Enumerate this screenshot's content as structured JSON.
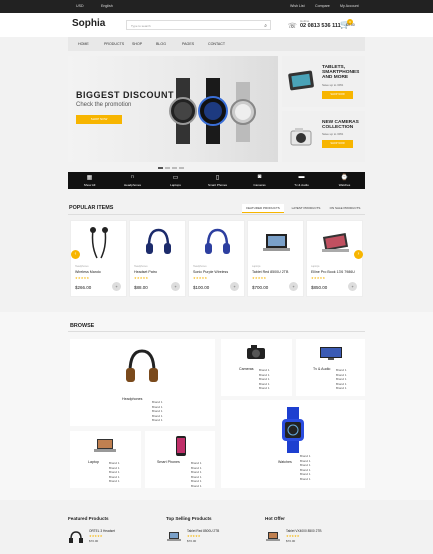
{
  "topbar": {
    "currency": "USD",
    "language": "English",
    "wishlist": "Wish List",
    "compare": "Compare",
    "account": "My Account"
  },
  "header": {
    "logo": "Sophia",
    "search_placeholder": "Type to search",
    "phone_label": "Hotline",
    "phone": "02 0813 536 111",
    "cart_count": "0",
    "cart_total": "$0.00"
  },
  "nav": [
    "HOME",
    "PRODUCTS",
    "SHOP",
    "BLOG",
    "PAGES",
    "CONTACT"
  ],
  "hero": {
    "title": "BIGGEST DISCOUNT",
    "subtitle": "Check the promotion",
    "button": "SHOP NOW"
  },
  "side_banners": [
    {
      "title1": "TABLETS,",
      "title2": "SMARTPHONES",
      "title3": "AND MORE",
      "sub": "Save up to 30%",
      "button": "SHOP NOW"
    },
    {
      "title1": "NEW CAMERAS",
      "title2": "COLLECTION",
      "title3": "",
      "sub": "Save up to 30%",
      "button": "SHOP NOW"
    }
  ],
  "categories": [
    {
      "label": "Show All",
      "icon": "grid-icon"
    },
    {
      "label": "Headphones",
      "icon": "headphones-icon"
    },
    {
      "label": "Laptops",
      "icon": "laptop-icon"
    },
    {
      "label": "Smart Phones",
      "icon": "phone-icon"
    },
    {
      "label": "Cameras",
      "icon": "camera-icon"
    },
    {
      "label": "Tv & Audio",
      "icon": "tv-icon"
    },
    {
      "label": "Watches",
      "icon": "watch-icon"
    }
  ],
  "popular": {
    "title": "POPULAR ITEMS",
    "tabs": [
      "FEATURED PRODUCTS",
      "LATEST PRODUCTS",
      "ON SALE PRODUCTS"
    ],
    "products": [
      {
        "name": "Wireless Mando",
        "category": "Headphones",
        "price": "$266.00",
        "stars": "★★★★★"
      },
      {
        "name": "Headset Patro",
        "category": "Headphones",
        "price": "$88.00",
        "stars": "★★★★★"
      },
      {
        "name": "Sonic Purple Wireless",
        "category": "Headphones",
        "price": "$100.00",
        "stars": "★★★★★"
      },
      {
        "name": "Tablet Red 8500U 2TB",
        "category": "Laptops",
        "price": "$700.00",
        "stars": "★★★★★"
      },
      {
        "name": "Elline Pro Book 13'6 7986U",
        "category": "Laptops",
        "price": "$850.00",
        "stars": "★★★★★"
      }
    ]
  },
  "browse": {
    "title": "BROWSE",
    "groups": [
      {
        "name": "Headphones",
        "brands": [
          "Brand 1",
          "Brand 1",
          "Brand 1",
          "Brand 1",
          "Brand 1",
          "Brand 1"
        ]
      },
      {
        "name": "Cameras",
        "brands": [
          "Brand 1",
          "Brand 1",
          "Brand 1",
          "Brand 1",
          "Brand 1"
        ]
      },
      {
        "name": "Tv & Audio",
        "brands": [
          "Brand 1",
          "Brand 1",
          "Brand 1",
          "Brand 1",
          "Brand 1"
        ]
      },
      {
        "name": "Laptop",
        "brands": [
          "Brand 1",
          "Brand 1",
          "Brand 1",
          "Brand 1",
          "Brand 1"
        ]
      },
      {
        "name": "Smart Phones",
        "brands": [
          "Brand 1",
          "Brand 1",
          "Brand 1",
          "Brand 1",
          "Brand 1",
          "Brand 1"
        ]
      },
      {
        "name": "Watches",
        "brands": [
          "Brand 1",
          "Brand 1",
          "Brand 1",
          "Brand 1",
          "Brand 1",
          "Brand 1"
        ]
      }
    ]
  },
  "bottom": {
    "featured": {
      "title": "Featured Products",
      "name": "ORTEL 3 Headset",
      "price": "$70.00",
      "stars": "★★★★★"
    },
    "top_selling": {
      "title": "Top Selling Products",
      "name": "Tablet Red 8500U 2TB",
      "price": "$70.00",
      "stars": "★★★★★"
    },
    "hot_offer": {
      "title": "Hot Offer",
      "name": "Tablet VX4000 8500 2TB",
      "price": "$70.00",
      "stars": "★★★★★"
    }
  },
  "colors": {
    "accent": "#f7b500",
    "dark": "#111111"
  }
}
